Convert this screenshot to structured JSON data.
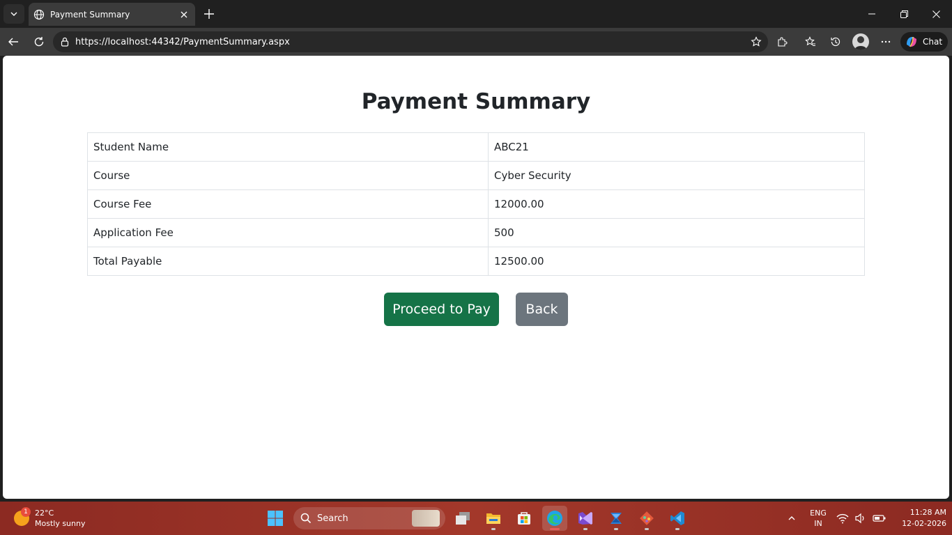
{
  "browser": {
    "tab_title": "Payment Summary",
    "url": "https://localhost:44342/PaymentSummary.aspx",
    "chat_label": "Chat"
  },
  "page": {
    "title": "Payment Summary",
    "rows": [
      {
        "label": "Student Name",
        "value": "ABC21"
      },
      {
        "label": "Course",
        "value": "Cyber Security"
      },
      {
        "label": "Course Fee",
        "value": "12000.00"
      },
      {
        "label": "Application Fee",
        "value": "500"
      },
      {
        "label": "Total Payable",
        "value": "12500.00"
      }
    ],
    "proceed_label": "Proceed to Pay",
    "back_label": "Back"
  },
  "taskbar": {
    "weather_badge": "1",
    "weather_temp": "22°C",
    "weather_desc": "Mostly sunny",
    "search_label": "Search",
    "lang_1": "ENG",
    "lang_2": "IN",
    "time": "11:28 AM",
    "date": "12-02-2026"
  },
  "colors": {
    "proceed_button": "#157347",
    "back_button": "#6c757d",
    "taskbar": "#a3382a"
  },
  "icons": [
    "tab-list-icon",
    "globe-icon",
    "close-icon",
    "plus-icon",
    "minimize-icon",
    "restore-icon",
    "window-close-icon",
    "back-arrow-icon",
    "refresh-icon",
    "lock-icon",
    "star-icon",
    "extensions-icon",
    "favorites-icon",
    "history-icon",
    "more-icon",
    "copilot-icon",
    "windows-logo-icon",
    "search-icon",
    "task-view-icon",
    "file-explorer-icon",
    "store-icon",
    "edge-icon",
    "visual-studio-icon",
    "sql-server-icon",
    "git-icon",
    "vscode-icon",
    "chevron-up-icon",
    "wifi-icon",
    "speaker-icon",
    "battery-icon"
  ]
}
